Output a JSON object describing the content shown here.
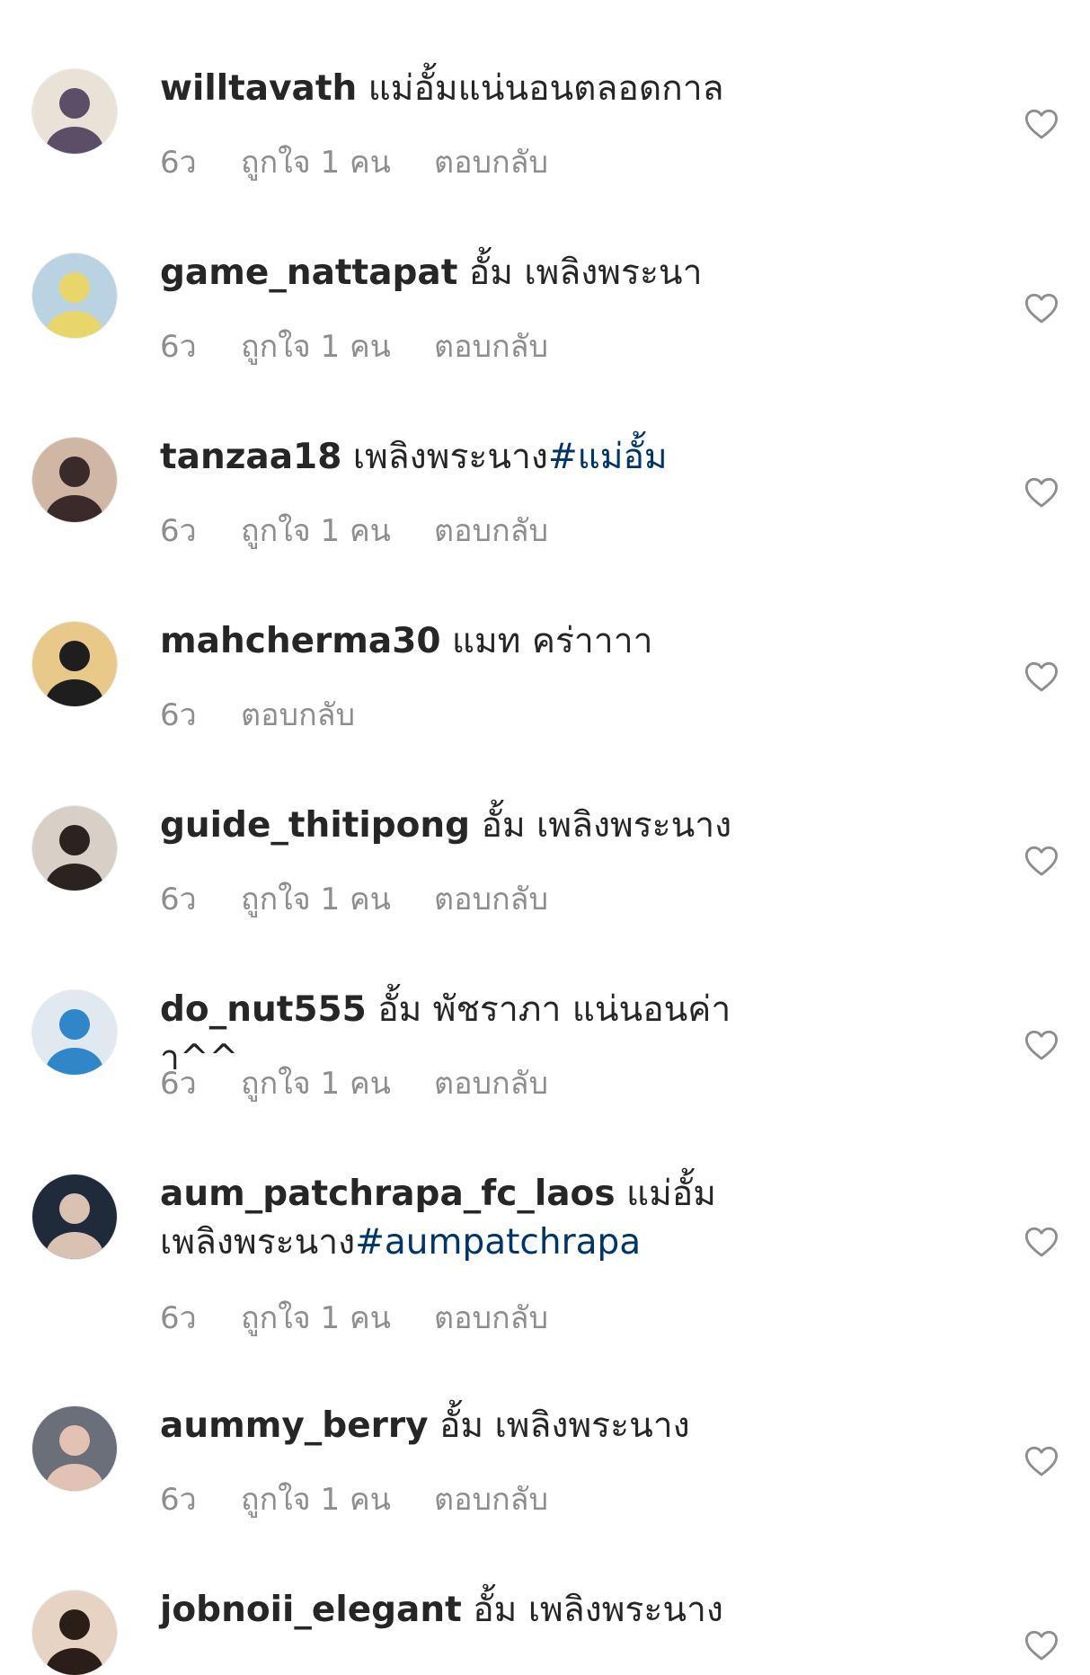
{
  "comments": [
    {
      "username": "willtavath",
      "text": "แม่อั้มแน่นอนตลอดกาล",
      "hashtag": "",
      "time": "6ว",
      "likes": "ถูกใจ 1 คน",
      "reply": "ตอบกลับ",
      "avatar_bg": "#e9e2d6",
      "avatar_fg": "#5a4f66"
    },
    {
      "username": "game_nattapat",
      "text": "อั้ม เพลิงพระนา",
      "hashtag": "",
      "time": "6ว",
      "likes": "ถูกใจ 1 คน",
      "reply": "ตอบกลับ",
      "avatar_bg": "#b9d3e2",
      "avatar_fg": "#e9d66b"
    },
    {
      "username": "tanzaa18",
      "text": "เพลิงพระนาง",
      "hashtag": "#แม่อั้ม",
      "time": "6ว",
      "likes": "ถูกใจ 1 คน",
      "reply": "ตอบกลับ",
      "avatar_bg": "#cfb7a4",
      "avatar_fg": "#3b2a2a"
    },
    {
      "username": "mahcherma30",
      "text": "แมท คร่าาาา",
      "hashtag": "",
      "time": "6ว",
      "likes": "",
      "reply": "ตอบกลับ",
      "avatar_bg": "#e8c98a",
      "avatar_fg": "#1e1e1e"
    },
    {
      "username": "guide_thitipong",
      "text": "อั้ม เพลิงพระนาง",
      "hashtag": "",
      "time": "6ว",
      "likes": "ถูกใจ 1 คน",
      "reply": "ตอบกลับ",
      "avatar_bg": "#d8cfc6",
      "avatar_fg": "#2a2320"
    },
    {
      "username": "do_nut555",
      "text": "อั้ม พัชราภา แน่นอนค่าา^^",
      "hashtag": "",
      "time": "6ว",
      "likes": "ถูกใจ 1 คน",
      "reply": "ตอบกลับ",
      "avatar_bg": "#dfe9ef",
      "avatar_fg": "#2f86c9"
    },
    {
      "username": "aum_patchrapa_fc_laos",
      "text": "แม่อั้มเพลิงพระนาง",
      "hashtag": "#aumpatchrapa",
      "time": "6ว",
      "likes": "ถูกใจ 1 คน",
      "reply": "ตอบกลับ",
      "avatar_bg": "#1f2a3a",
      "avatar_fg": "#d9c2b2"
    },
    {
      "username": "aummy_berry",
      "text": "อั้ม เพลิงพระนาง",
      "hashtag": "",
      "time": "6ว",
      "likes": "ถูกใจ 1 คน",
      "reply": "ตอบกลับ",
      "avatar_bg": "#6b6f7a",
      "avatar_fg": "#e2c2b2"
    },
    {
      "username": "jobnoii_elegant",
      "text": "อั้ม เพลิงพระนาง",
      "hashtag": "",
      "time": "",
      "likes": "",
      "reply": "",
      "avatar_bg": "#e7d3c4",
      "avatar_fg": "#2b1d18"
    }
  ],
  "colors": {
    "text": "#262626",
    "meta": "#8e8e8e",
    "hashtag": "#003569",
    "heart_outline": "#8e8e8e"
  },
  "icons": {
    "like": "heart-outline-icon",
    "avatar": "avatar-photo"
  }
}
